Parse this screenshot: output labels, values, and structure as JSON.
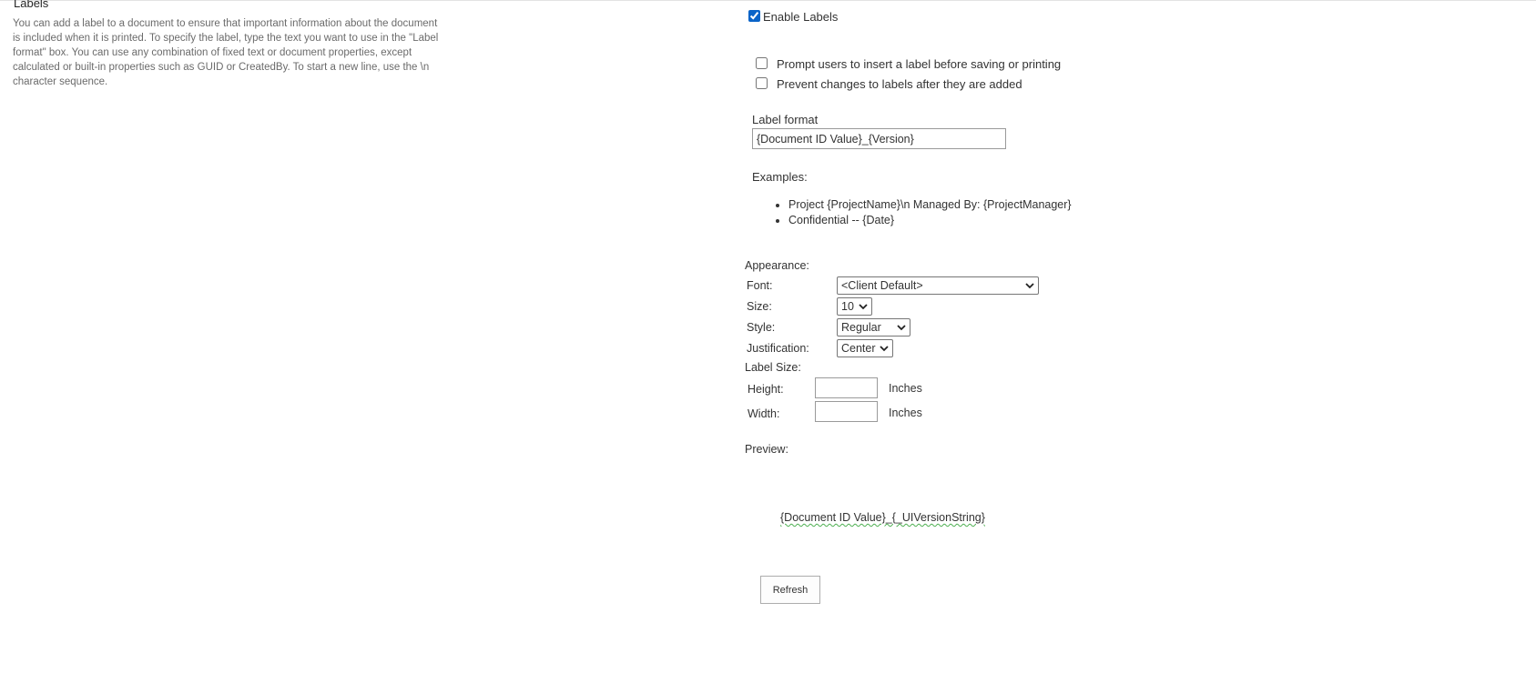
{
  "section": {
    "title": "Labels",
    "description": "You can add a label to a document to ensure that important information about the document is included when it is printed. To specify the label, type the text you want to use in the \"Label format\" box. You can use any combination of fixed text or document properties, except calculated or built-in properties such as GUID or CreatedBy. To start a new line, use the \\n character sequence."
  },
  "enable_labels": {
    "label": "Enable Labels",
    "checked": true
  },
  "options": [
    {
      "label": "Prompt users to insert a label before saving or printing",
      "checked": false
    },
    {
      "label": "Prevent changes to labels after they are added",
      "checked": false
    }
  ],
  "label_format": {
    "heading": "Label format",
    "value": "{Document ID Value}_{Version}"
  },
  "examples": {
    "heading": "Examples:",
    "items": [
      "Project {ProjectName}\\n Managed By: {ProjectManager}",
      "Confidential -- {Date}"
    ]
  },
  "appearance": {
    "heading": "Appearance:",
    "font": {
      "label": "Font:",
      "value": "<Client Default>"
    },
    "size": {
      "label": "Size:",
      "value": "10"
    },
    "style": {
      "label": "Style:",
      "value": "Regular"
    },
    "justification": {
      "label": "Justification:",
      "value": "Center"
    }
  },
  "label_size": {
    "heading": "Label Size:",
    "height": {
      "label": "Height:",
      "value": "",
      "unit": "Inches"
    },
    "width": {
      "label": "Width:",
      "value": "",
      "unit": "Inches"
    }
  },
  "preview": {
    "heading": "Preview:",
    "text": "{Document ID Value}_{_UIVersionString}"
  },
  "refresh_button": {
    "label": "Refresh"
  },
  "colors": {
    "checkbox_accent": "#0a64c8",
    "spellcheck_underline": "#4caf50"
  },
  "icons": {
    "dropdown": "chevron-down-icon"
  }
}
